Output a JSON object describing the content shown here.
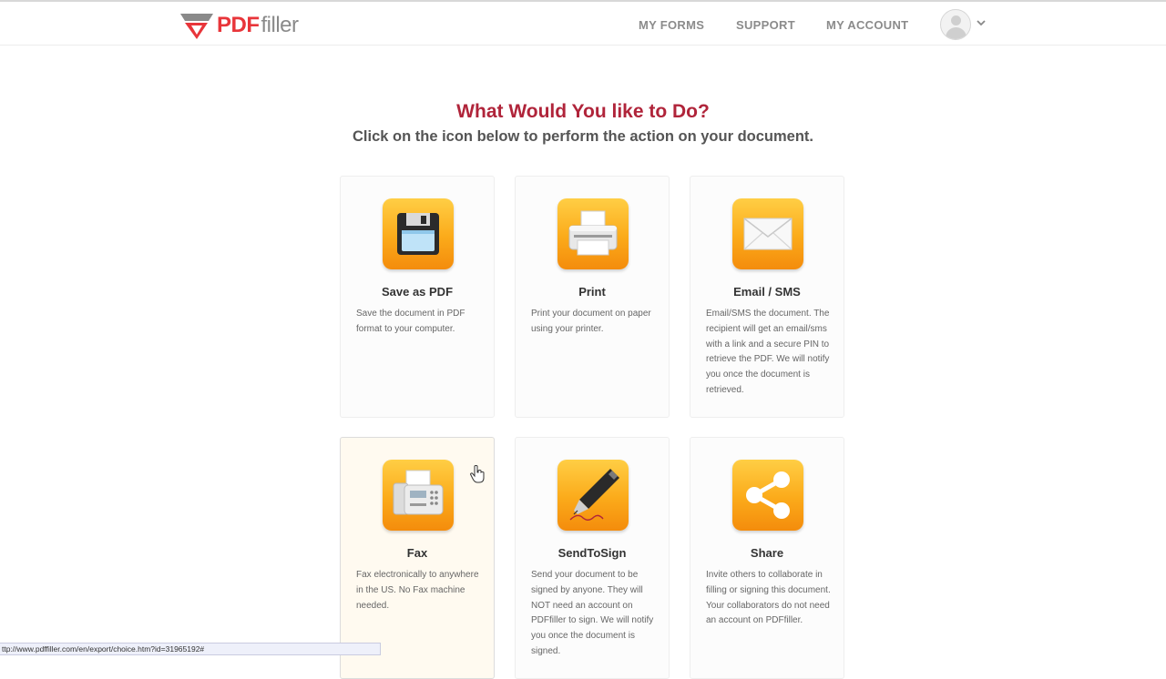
{
  "header": {
    "logo": {
      "brand_pdf": "PDF",
      "brand_filler": "filler"
    },
    "nav": [
      "MY FORMS",
      "SUPPORT",
      "MY ACCOUNT"
    ]
  },
  "main": {
    "title": "What Would You like to Do?",
    "subtitle": "Click on the icon below to perform the action on your document.",
    "actions": [
      {
        "title": "Save as PDF",
        "description": "Save the document in PDF format to your computer.",
        "icon": "floppy-disk-icon"
      },
      {
        "title": "Print",
        "description": "Print your document on paper using your printer.",
        "icon": "printer-icon"
      },
      {
        "title": "Email / SMS",
        "description": "Email/SMS the document. The recipient will get an email/sms with a link and a secure PIN to retrieve the PDF. We will notify you once the document is retrieved.",
        "icon": "envelope-icon"
      },
      {
        "title": "Fax",
        "description": "Fax electronically to anywhere in the US. No Fax machine needed.",
        "icon": "fax-machine-icon"
      },
      {
        "title": "SendToSign",
        "description": "Send your document to be signed by anyone. They will NOT need an account on PDFfiller to sign. We will notify you once the document is signed.",
        "icon": "pen-icon"
      },
      {
        "title": "Share",
        "description": "Invite others to collaborate in filling or signing this document. Your collaborators do not need an account on PDFfiller.",
        "icon": "share-icon"
      }
    ]
  },
  "status_bar": {
    "url": "ttp://www.pdffiller.com/en/export/choice.htm?id=31965192#"
  },
  "colors": {
    "brand_red": "#e8353a",
    "title_red": "#b0243a",
    "icon_orange": "#fbaa1a"
  }
}
